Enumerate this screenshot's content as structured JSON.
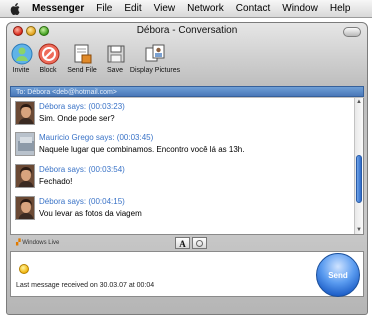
{
  "menubar": {
    "apple_icon": "apple-icon",
    "items": [
      "Messenger",
      "File",
      "Edit",
      "View",
      "Network",
      "Contact",
      "Window",
      "Help"
    ]
  },
  "window": {
    "title": "Débora - Conversation",
    "toolbar": [
      {
        "label": "Invite",
        "icon": "invite-icon"
      },
      {
        "label": "Block",
        "icon": "block-icon"
      },
      {
        "label": "Send File",
        "icon": "send-file-icon"
      },
      {
        "label": "Save",
        "icon": "save-icon"
      },
      {
        "label": "Display Pictures",
        "icon": "display-pictures-icon"
      }
    ]
  },
  "conversation": {
    "to": "To: Débora <deb@hotmail.com>",
    "messages": [
      {
        "sender": "Débora says: (00:03:23)",
        "text": "Sim. Onde pode ser?",
        "avatar": "debora"
      },
      {
        "sender": "Mauricio Grego says: (00:03:45)",
        "text": "Naquele lugar que combinamos. Encontro você lá as 13h.",
        "avatar": "mauricio"
      },
      {
        "sender": "Débora says: (00:03:54)",
        "text": "Fechado!",
        "avatar": "debora"
      },
      {
        "sender": "Débora says: (00:04:15)",
        "text": "Vou levar as fotos da viagem",
        "avatar": "debora"
      }
    ]
  },
  "compose": {
    "windows_live": "Windows Live",
    "font_button": "A",
    "send": "Send"
  },
  "status": "Last message received on 30.03.07 at 00:04",
  "colors": {
    "sender_blue": "#3a73c7",
    "send_button": "#1e5fc8",
    "to_bar": "#4a78b8"
  }
}
